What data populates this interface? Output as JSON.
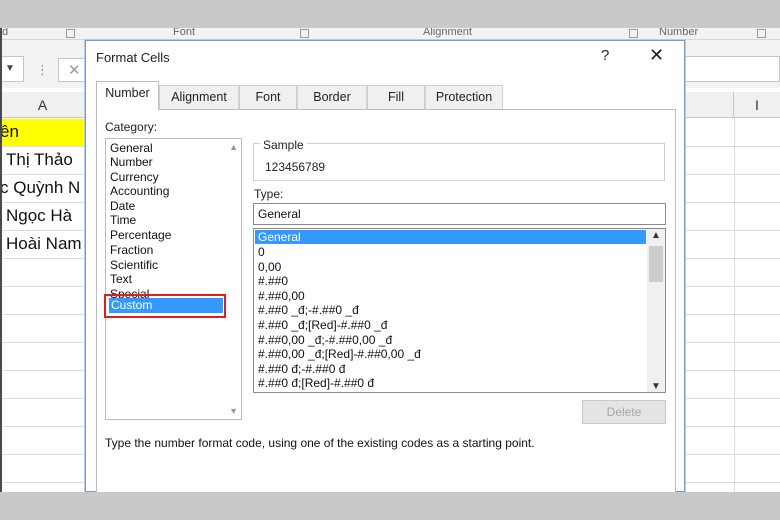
{
  "ribbon": {
    "groups": [
      "d",
      "Font",
      "Alignment",
      "Number"
    ]
  },
  "sheet": {
    "col_a": "A",
    "col_i": "I",
    "cells": [
      "ên",
      "Thị Thảo",
      "c Quỳnh N",
      "Ngọc Hà",
      "Hoài Nam"
    ]
  },
  "dialog": {
    "title": "Format Cells",
    "help": "?",
    "close": "✕",
    "tabs": [
      "Number",
      "Alignment",
      "Font",
      "Border",
      "Fill",
      "Protection"
    ],
    "active_tab": "Number",
    "category_label": "Category:",
    "categories": [
      "General",
      "Number",
      "Currency",
      "Accounting",
      "Date",
      "Time",
      "Percentage",
      "Fraction",
      "Scientific",
      "Text",
      "Special",
      "Custom"
    ],
    "selected_category": "Custom",
    "sample_label": "Sample",
    "sample_value": "123456789",
    "type_label": "Type:",
    "type_value": "General",
    "formats": [
      "General",
      "0",
      "0,00",
      "#.##0",
      "#.##0,00",
      "#.##0 _đ;-#.##0 _đ",
      "#.##0 _đ;[Red]-#.##0 _đ",
      "#.##0,00 _đ;-#.##0,00 _đ",
      "#.##0,00 _đ;[Red]-#.##0,00 _đ",
      "#.##0 đ;-#.##0 đ",
      "#.##0 đ;[Red]-#.##0 đ"
    ],
    "delete_label": "Delete",
    "hint": "Type the number format code, using one of the existing codes as a starting point."
  }
}
